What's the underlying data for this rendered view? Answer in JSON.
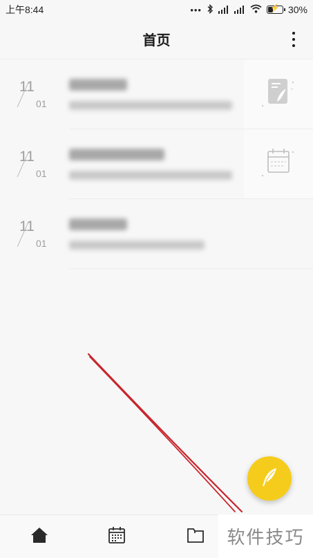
{
  "status_bar": {
    "time": "上午8:44",
    "battery_percent": "30%",
    "icons": [
      "dots-icon",
      "bluetooth-icon",
      "signal-icon",
      "signal-icon",
      "wifi-icon",
      "battery-charging-icon"
    ]
  },
  "app_bar": {
    "title": "首页",
    "menu_icon": "more-vertical-icon"
  },
  "notes": [
    {
      "day": "11",
      "month": "01",
      "title_blurred": true,
      "subtitle_blurred": true,
      "thumb_icon": "note-feather-icon"
    },
    {
      "day": "11",
      "month": "01",
      "title_blurred": true,
      "subtitle_blurred": true,
      "thumb_icon": "calendar-icon"
    },
    {
      "day": "11",
      "month": "01",
      "title_blurred": true,
      "subtitle_blurred": true,
      "thumb_icon": ""
    }
  ],
  "fab": {
    "icon": "feather-icon",
    "color": "#f5cc1b"
  },
  "bottom_nav": {
    "items": [
      {
        "icon": "home-icon"
      },
      {
        "icon": "calendar-icon"
      },
      {
        "icon": "folder-icon"
      }
    ]
  },
  "watermark": {
    "text": "软件技巧"
  },
  "colors": {
    "accent": "#f5cc1b",
    "annotation": "#c8262e"
  }
}
